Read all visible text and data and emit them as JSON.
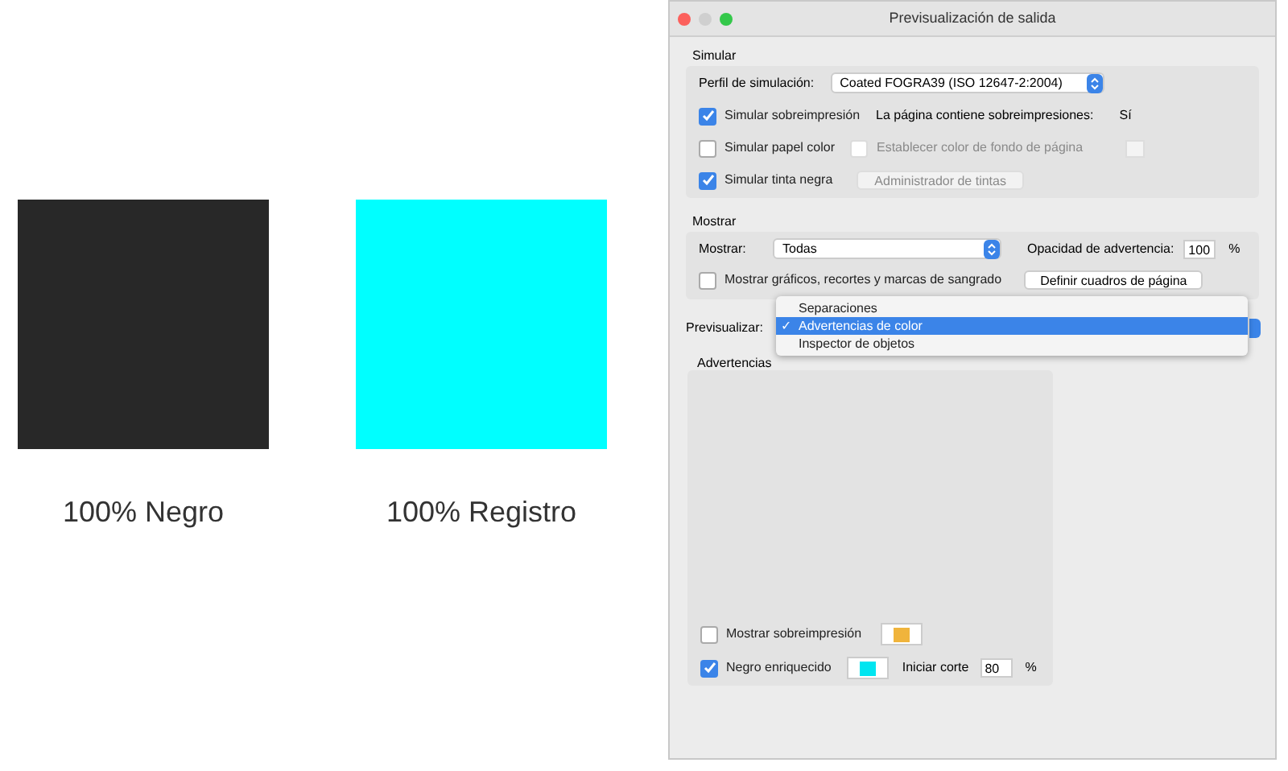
{
  "swatches": [
    {
      "label": "100% Negro",
      "color": "#282828"
    },
    {
      "label": "100% Registro",
      "color": "#00ffff"
    }
  ],
  "window": {
    "title": "Previsualización de salida"
  },
  "simular": {
    "heading": "Simular",
    "profile_label": "Perfil de simulación:",
    "profile_value": "Coated FOGRA39 (ISO 12647-2:2004)",
    "overprint": {
      "label": "Simular sobreimpresión",
      "checked": true
    },
    "overprint_info": "La página contiene sobreimpresiones:",
    "overprint_value": "Sí",
    "paper": {
      "label": "Simular papel color",
      "checked": false
    },
    "paper_bg": {
      "label": "Establecer color de fondo de página",
      "checked": false,
      "disabled": true
    },
    "black_ink": {
      "label": "Simular tinta negra",
      "checked": true
    },
    "ink_manager": {
      "label": "Administrador de tintas",
      "disabled": true
    }
  },
  "mostrar": {
    "heading": "Mostrar",
    "show_label": "Mostrar:",
    "show_value": "Todas",
    "opacity_label": "Opacidad de advertencia:",
    "opacity_value": "100",
    "opacity_unit": "%",
    "marks": {
      "label": "Mostrar gráficos, recortes y marcas de sangrado",
      "checked": false
    },
    "define_button": "Definir cuadros de página"
  },
  "preview": {
    "label": "Previsualizar:",
    "options": [
      {
        "label": "Separaciones",
        "selected": false
      },
      {
        "label": "Advertencias de color",
        "selected": true
      },
      {
        "label": "Inspector de objetos",
        "selected": false
      }
    ],
    "check_glyph": "✓"
  },
  "advertencias": {
    "heading": "Advertencias",
    "overprint": {
      "label": "Mostrar sobreimpresión",
      "checked": false,
      "color": "#f0b43c"
    },
    "rich_black": {
      "label": "Negro enriquecido",
      "checked": true,
      "color": "#00e5f0"
    },
    "cut_label": "Iniciar corte",
    "cut_value": "80",
    "cut_unit": "%"
  }
}
